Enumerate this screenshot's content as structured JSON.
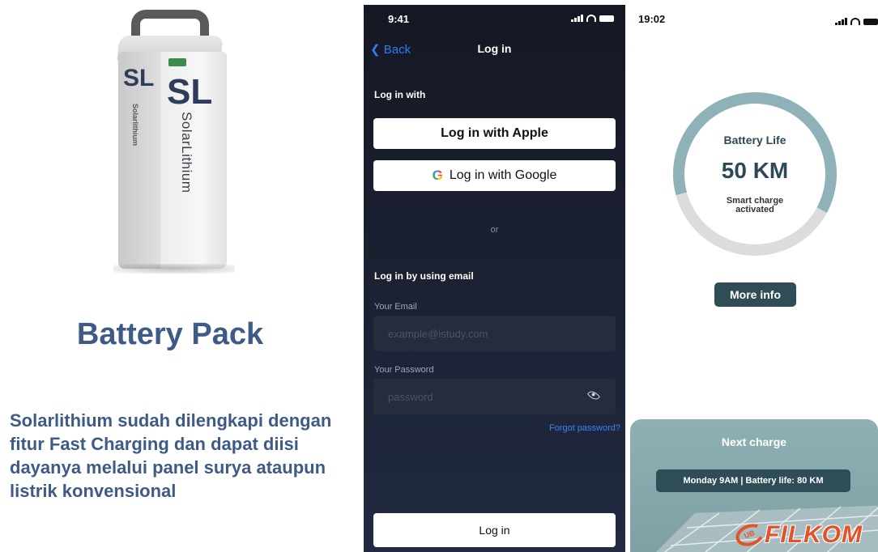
{
  "left": {
    "product_logo_mark": "SL",
    "product_brand": "SolarLithium",
    "product_brand_side": "Solarlithium",
    "title": "Battery Pack",
    "description": "Solarlithium sudah dilengkapi dengan fitur Fast Charging dan dapat diisi dayanya melalui panel surya ataupun listrik konvensional"
  },
  "login_screen": {
    "status_time": "9:41",
    "back_label": "Back",
    "title": "Log in",
    "login_with_label": "Log in with",
    "apple_button": "Log in with Apple",
    "google_icon": "G",
    "google_button": "Log in with Google",
    "or_label": "or",
    "email_section_label": "Log in by using email",
    "email_label": "Your Email",
    "email_placeholder": "example@istudy.com",
    "password_label": "Your Password",
    "password_placeholder": "password",
    "forgot_label": "Forgot password?",
    "login_button": "Log in"
  },
  "battery_screen": {
    "status_time": "19:02",
    "gauge_label": "Battery Life",
    "gauge_value": "50 KM",
    "gauge_sub_line1": "Smart charge",
    "gauge_sub_line2": "activated",
    "gauge_fill_fraction": 0.62,
    "more_info_button": "More info",
    "next_charge_title": "Next charge",
    "next_charge_detail": "Monday 9AM | Battery life: 80 KM",
    "watermark_mark": "UB",
    "watermark": "FILKOM"
  },
  "colors": {
    "heading_blue": "#3e5a86",
    "dark_bg": "#1b2031",
    "link_blue": "#2f7bf5",
    "teal_dark": "#2e4d56",
    "teal_light": "#8fb0b3",
    "gauge_fill": "#8fb2b8",
    "gauge_track": "#dcdcdc",
    "brand_orange": "#e2532a"
  }
}
